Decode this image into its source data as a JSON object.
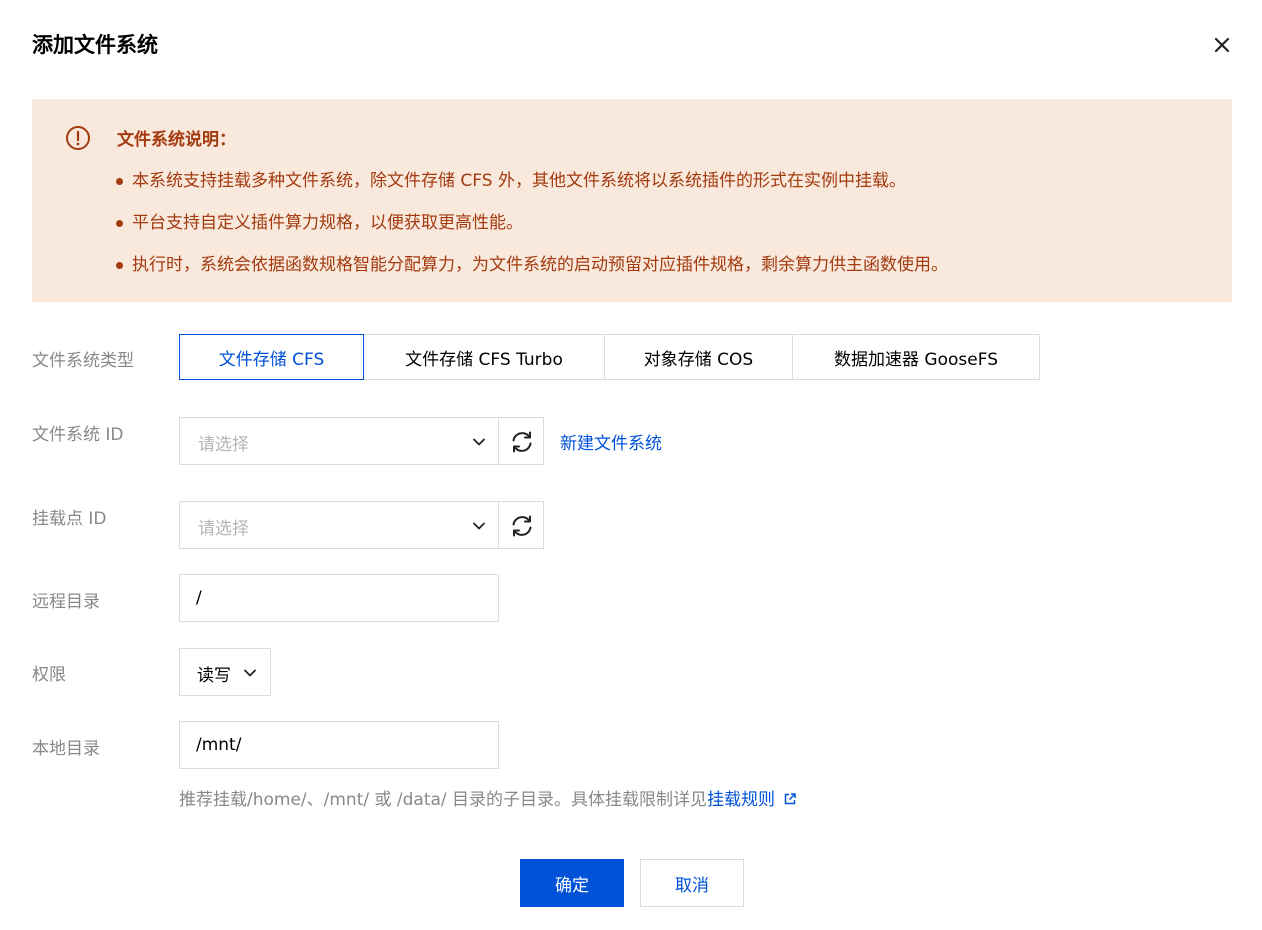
{
  "dialog": {
    "title": "添加文件系统",
    "close_icon": "close-icon"
  },
  "notice": {
    "icon": "warning-circle-icon",
    "title": "文件系统说明：",
    "items": [
      "本系统支持挂载多种文件系统，除文件存储 CFS 外，其他文件系统将以系统插件的形式在实例中挂载。",
      "平台支持自定义插件算力规格，以便获取更高性能。",
      "执行时，系统会依据函数规格智能分配算力，为文件系统的启动预留对应插件规格，剩余算力供主函数使用。"
    ]
  },
  "form": {
    "fs_type": {
      "label": "文件系统类型",
      "options": [
        "文件存储 CFS",
        "文件存储 CFS Turbo",
        "对象存储 COS",
        "数据加速器 GooseFS"
      ],
      "selected": "文件存储 CFS"
    },
    "fs_id": {
      "label": "文件系统 ID",
      "placeholder": "请选择",
      "create_link": "新建文件系统"
    },
    "mount_point": {
      "label": "挂载点 ID",
      "placeholder": "请选择"
    },
    "remote_dir": {
      "label": "远程目录",
      "value": "/"
    },
    "permission": {
      "label": "权限",
      "value": "读写"
    },
    "local_dir": {
      "label": "本地目录",
      "value": "/mnt/",
      "hint": "推荐挂载/home/、/mnt/ 或 /data/ 目录的子目录。具体挂载限制详见",
      "hint_link": "挂载规则"
    }
  },
  "footer": {
    "confirm": "确定",
    "cancel": "取消"
  },
  "colors": {
    "accent": "#0052d9",
    "notice_bg": "#f9e9dc",
    "notice_text": "#a33a10"
  }
}
